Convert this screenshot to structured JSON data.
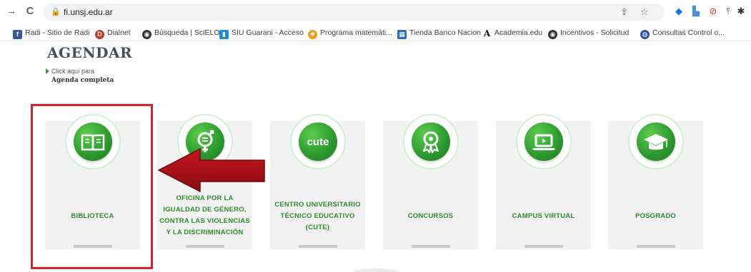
{
  "browser": {
    "url": "fi.unsj.edu.ar",
    "nav": {
      "back": "→",
      "reload": "C"
    }
  },
  "bookmarks": [
    {
      "label": "Radi - Sitio de Radi",
      "icon": "f",
      "color": "#3b5998"
    },
    {
      "label": "Dialnet",
      "icon": "D",
      "color": "#c0392b"
    },
    {
      "label": "Búsqueda | SciELO",
      "icon": "◉",
      "color": "#333333"
    },
    {
      "label": "SIU Guarani - Acceso",
      "icon": "▮",
      "color": "#1a8fd6"
    },
    {
      "label": "Programa matemáti...",
      "icon": "✹",
      "color": "#f39c12"
    },
    {
      "label": "Tienda Banco Nacion",
      "icon": "▦",
      "color": "#2d6cb5"
    },
    {
      "label": "Academia.edu",
      "icon": "A",
      "color": "#ffffff"
    },
    {
      "label": "Incentivos - Solicitud",
      "icon": "◉",
      "color": "#333333"
    },
    {
      "label": "Consultas Control o...",
      "icon": "◍",
      "color": "#2d4ea0"
    }
  ],
  "page": {
    "title": "AGENDAR",
    "click_here": "Click aquí para",
    "agenda_link": "Agenda completa"
  },
  "cards": [
    {
      "name": "biblioteca",
      "lines": [
        "BIBLIOTECA"
      ],
      "icon": "book-icon"
    },
    {
      "name": "oficina-igualdad",
      "lines": [
        "OFICINA POR LA",
        "IGUALDAD DE GÉNERO,",
        "CONTRA LAS VIOLENCIAS",
        "Y LA DISCRIMINACIÓN"
      ],
      "icon": "gender-icon"
    },
    {
      "name": "cute",
      "lines": [
        "CENTRO UNIVERSITARIO",
        "TÉCNICO EDUCATIVO",
        "(CUTE)"
      ],
      "icon": "cute-logo-icon",
      "logo_text": "cute"
    },
    {
      "name": "concursos",
      "lines": [
        "CONCURSOS"
      ],
      "icon": "award-icon"
    },
    {
      "name": "campus-virtual",
      "lines": [
        "CAMPUS VIRTUAL"
      ],
      "icon": "laptop-icon"
    },
    {
      "name": "posgrado",
      "lines": [
        "POSGRADO"
      ],
      "icon": "graduation-cap-icon"
    }
  ],
  "colors": {
    "accent_green": "#2f8a2f",
    "highlight_red": "#d6232a",
    "arrow_red": "#a5121b"
  }
}
